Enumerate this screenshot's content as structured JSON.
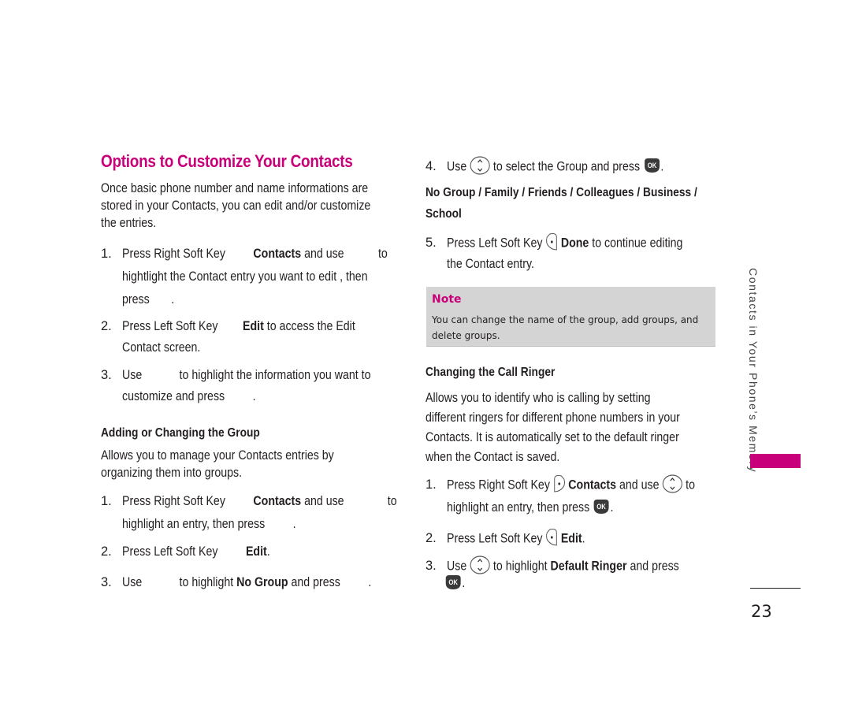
{
  "left": {
    "title": "Options to Customize Your Contacts",
    "intro": [
      "Once basic phone number and name informations are",
      "stored in your Contacts, you can edit and/or customize",
      "the entries."
    ],
    "steps": [
      {
        "num": "1.",
        "l1a": "Press Right Soft Key",
        "l1b": "Contacts",
        "l1c": "and use",
        "l1d": "to",
        "l2": "hightlight the Contact entry you want to edit , then",
        "l3a": "press",
        "l3b": "."
      },
      {
        "num": "2.",
        "l1a": "Press Left Soft Key",
        "l1b": "Edit",
        "l1c": "to access the Edit",
        "l2": "Contact screen."
      },
      {
        "num": "3.",
        "l1a": "Use",
        "l1b": "to highlight the information you want to",
        "l2a": "customize and press",
        "l2b": "."
      }
    ],
    "group_heading": "Adding or Changing the Group",
    "group_intro": [
      "Allows you to manage your Contacts entries by",
      "organizing them into groups."
    ],
    "group_steps": [
      {
        "num": "1.",
        "l1a": "Press Right Soft Key",
        "l1b": "Contacts",
        "l1c": "and use",
        "l1d": "to",
        "l2a": "highlight an entry, then press",
        "l2b": "."
      },
      {
        "num": "2.",
        "l1a": "Press Left Soft Key",
        "l1b": "Edit",
        "l1c": "."
      },
      {
        "num": "3.",
        "l1a": "Use",
        "l1b": "to highlight",
        "l1c": "No Group",
        "l1d": "and press",
        "l1e": "."
      }
    ]
  },
  "right": {
    "step4": {
      "num": "4.",
      "a": "Use",
      "b": "to select the Group and press",
      "c": "."
    },
    "group_options": [
      "No Group / Family / Friends / Colleagues / Business /",
      "School"
    ],
    "step5": {
      "num": "5.",
      "a": "Press Left Soft Key",
      "b": "Done",
      "c": "to continue editing",
      "l2": "the Contact entry."
    },
    "note": {
      "title": "Note",
      "body": [
        "You can change the name of the group, add groups, and",
        "delete groups."
      ]
    },
    "ringer_heading": "Changing the Call Ringer",
    "ringer_intro": [
      "Allows you to identify who is calling by setting",
      "different ringers for different phone numbers in your",
      "Contacts. It is automatically set to the default ringer",
      "when the Contact is saved."
    ],
    "ringer_steps": [
      {
        "num": "1.",
        "l1a": "Press Right Soft Key",
        "l1b": "Contacts",
        "l1c": "and use",
        "l1d": "to",
        "l2a": "highlight an entry, then press",
        "l2b": "."
      },
      {
        "num": "2.",
        "l1a": "Press Left Soft Key",
        "l1b": "Edit",
        "l1c": "."
      },
      {
        "num": "3.",
        "l1a": "Use",
        "l1b": "to highlight",
        "l1c": "Default Ringer",
        "l1d": "and press",
        "l2": "."
      }
    ]
  },
  "sidebar": {
    "section_label": "Contacts in Your Phone’s Memory",
    "accent_color": "#c8007a"
  },
  "footer": {
    "page_number": "23"
  },
  "icons": {
    "nav": "nav-key-icon",
    "ok": "ok-key-icon",
    "left_soft": "left-soft-key-icon",
    "right_soft": "right-soft-key-icon"
  }
}
